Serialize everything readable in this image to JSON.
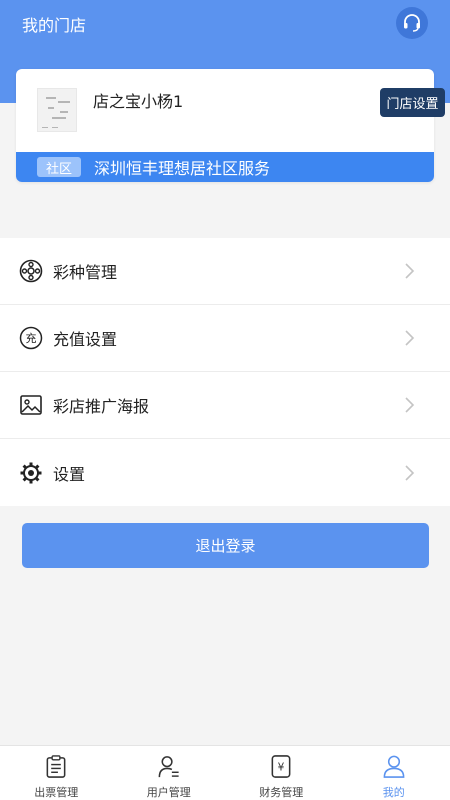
{
  "header": {
    "title": "我的门店"
  },
  "store": {
    "name": "店之宝小杨1",
    "settings_label": "门店设置",
    "community_tag": "社区",
    "community_name": "深圳恒丰理想居社区服务"
  },
  "menu": {
    "items": [
      {
        "label": "彩种管理",
        "icon": "ball-icon"
      },
      {
        "label": "充值设置",
        "icon": "recharge-icon"
      },
      {
        "label": "彩店推广海报",
        "icon": "poster-icon"
      },
      {
        "label": "设置",
        "icon": "gear-icon"
      }
    ]
  },
  "logout_label": "退出登录",
  "tabbar": {
    "active_index": 3,
    "tabs": [
      {
        "label": "出票管理",
        "icon": "clipboard-icon"
      },
      {
        "label": "用户管理",
        "icon": "user-list-icon"
      },
      {
        "label": "财务管理",
        "icon": "yen-icon"
      },
      {
        "label": "我的",
        "icon": "person-icon"
      }
    ]
  },
  "colors": {
    "primary": "#5b93ef",
    "community_bar": "#3d86f1",
    "settings_button": "#1f3d66",
    "background": "#f4f4f4"
  }
}
